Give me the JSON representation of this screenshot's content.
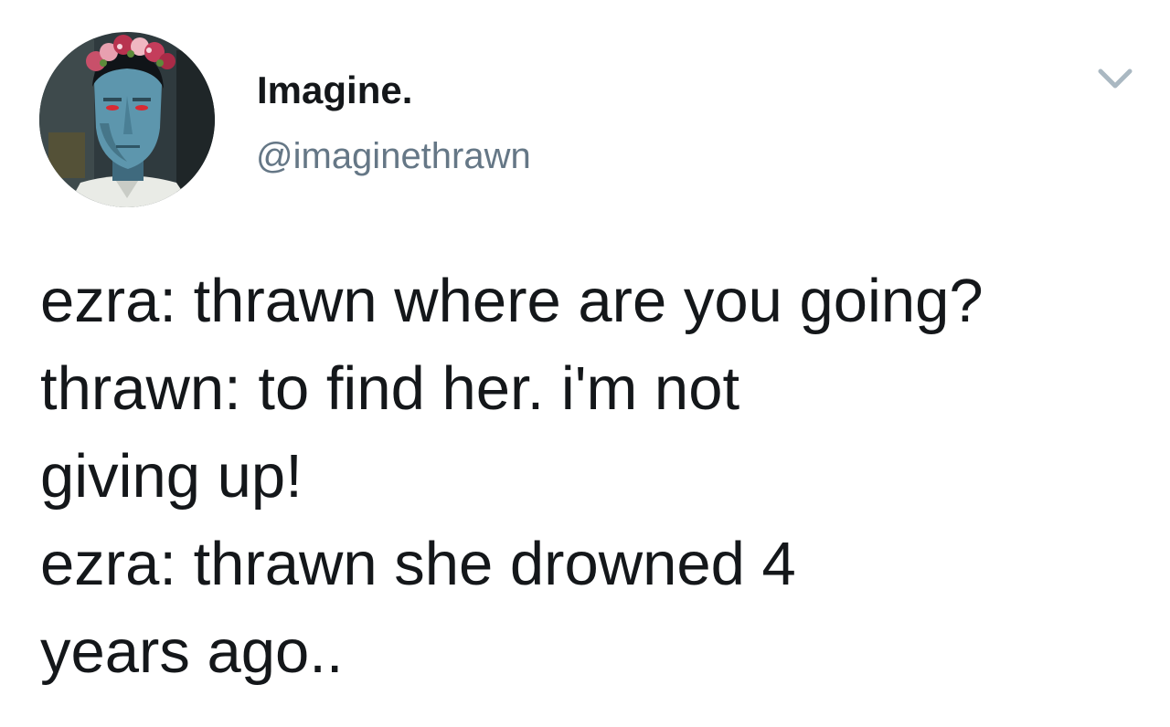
{
  "author": {
    "display_name": "Imagine.",
    "handle": "@imaginethrawn"
  },
  "menu": {
    "icon": "chevron-down-icon"
  },
  "tweet": {
    "lines": [
      "ezra: thrawn where are you going?",
      "thrawn: to find her. i'm not",
      "giving up!",
      "ezra: thrawn she drowned 4",
      "years ago.."
    ]
  },
  "colors": {
    "text": "#14171a",
    "secondary": "#657786",
    "icon": "#aab8c2"
  }
}
